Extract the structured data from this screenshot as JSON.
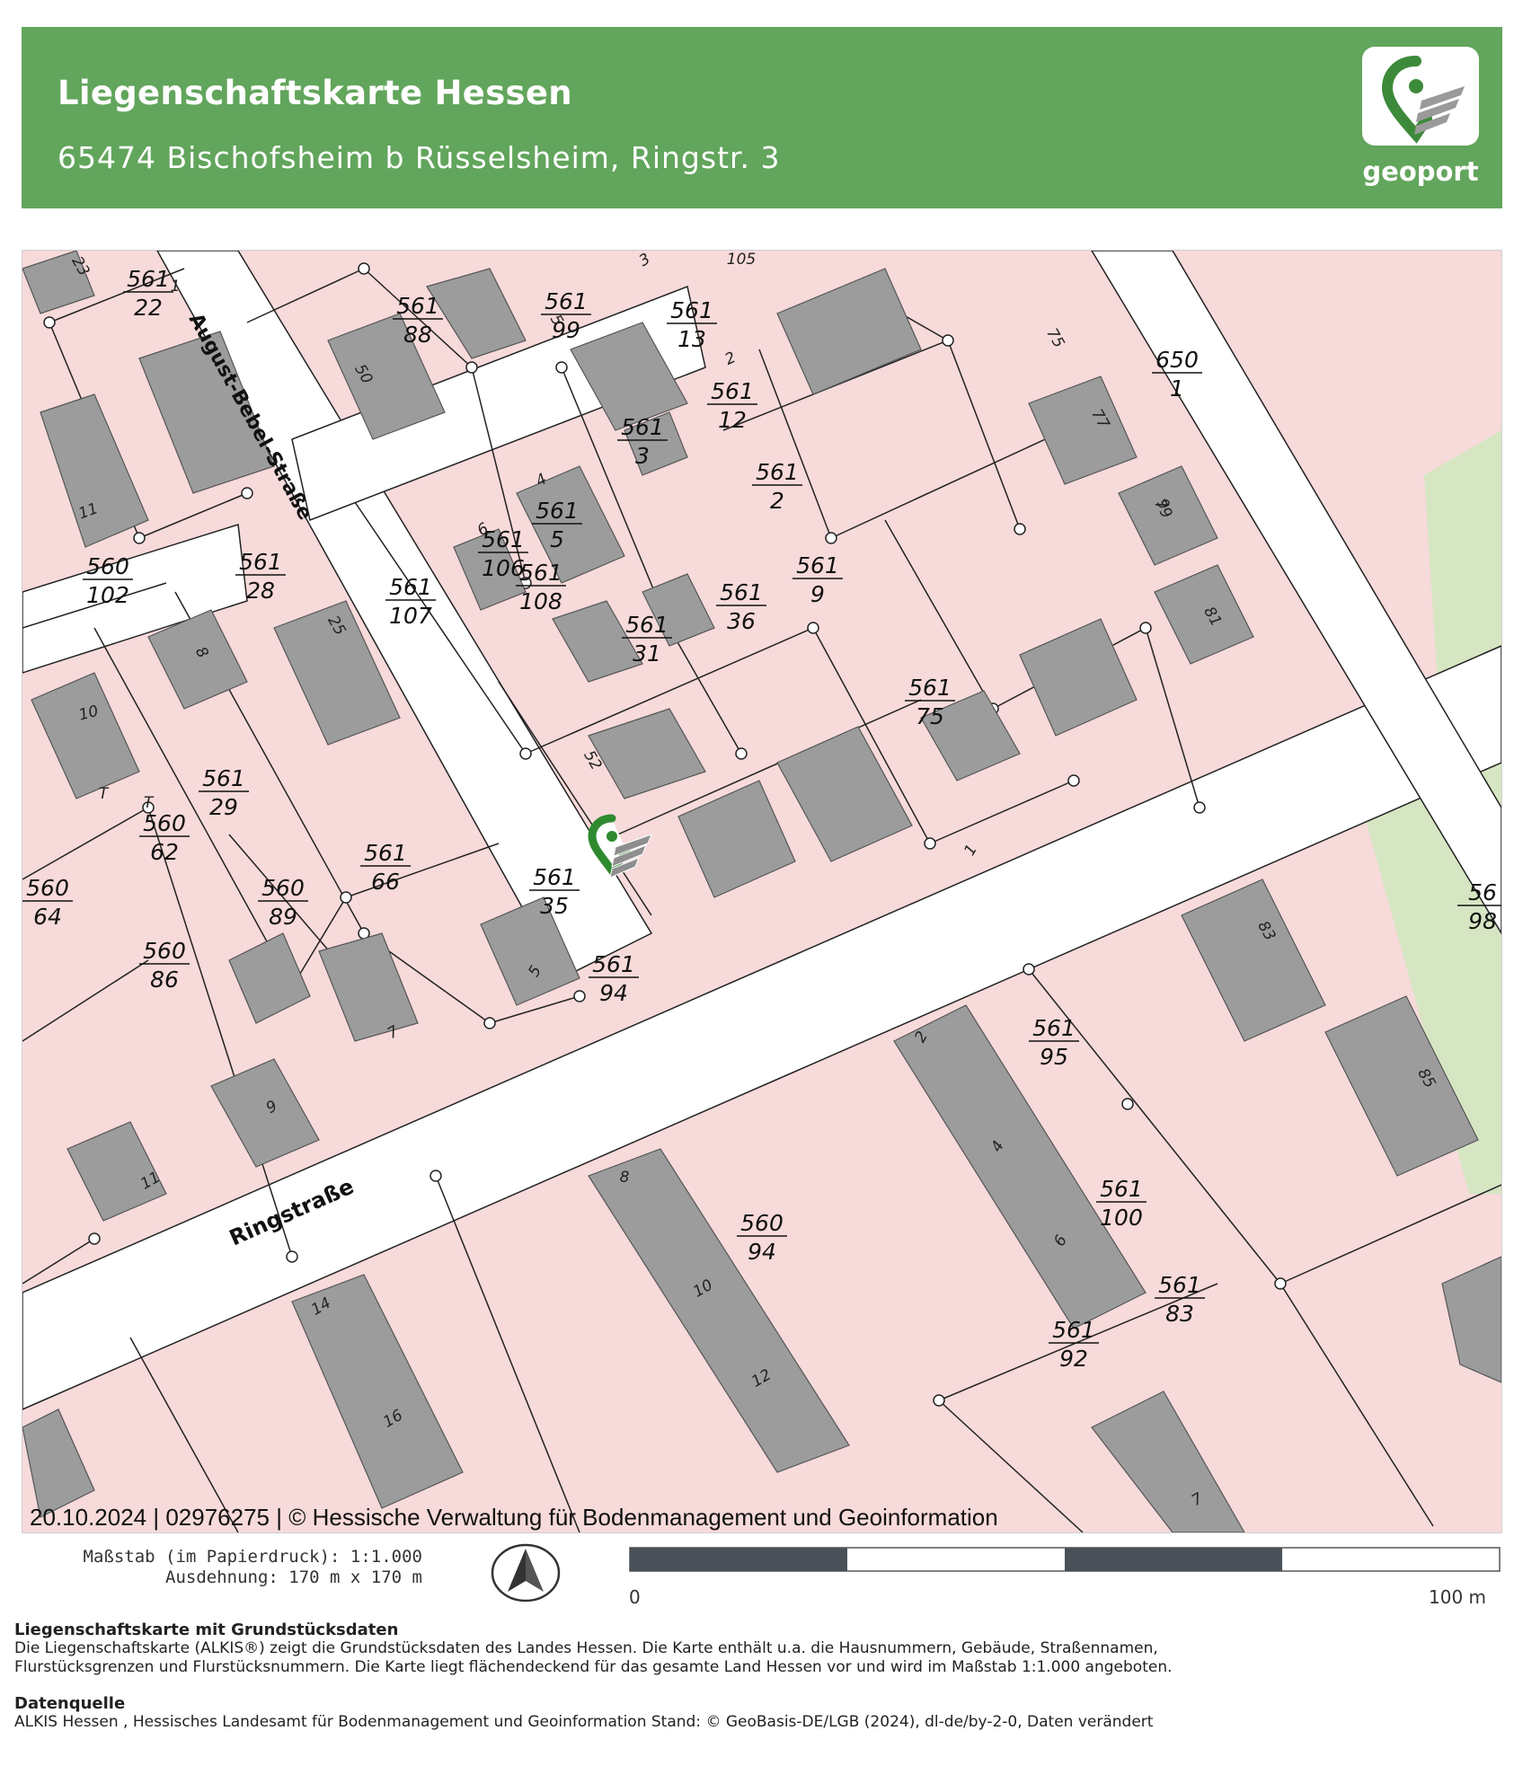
{
  "header": {
    "title": "Liegenschaftskarte Hessen",
    "address": "65474 Bischofsheim b Rüsselsheim, Ringstr. 3",
    "logo_text": "geoport",
    "background_color": "#62a55c"
  },
  "map": {
    "copyright": "20.10.2024 | 02976275 | © Hessische Verwaltung für Bodenmanagement und Geoinformation",
    "marker_icon": "location-pin-icon",
    "colors": {
      "parcel_fill": "#f7dada",
      "building_fill": "#9c9c9c",
      "green_fill": "#d6e6c3",
      "boundary": "#222222"
    },
    "streets": [
      "August-Bebel-Straße",
      "Ringstraße"
    ],
    "parcels": [
      {
        "top": "561",
        "bottom": "22"
      },
      {
        "top": "561",
        "bottom": "88"
      },
      {
        "top": "561",
        "bottom": "99"
      },
      {
        "top": "561",
        "bottom": "13"
      },
      {
        "top": "650",
        "bottom": "1"
      },
      {
        "top": "561",
        "bottom": "12"
      },
      {
        "top": "561",
        "bottom": "3"
      },
      {
        "top": "561",
        "bottom": "2"
      },
      {
        "top": "561",
        "bottom": "5"
      },
      {
        "top": "561",
        "bottom": "106"
      },
      {
        "top": "561",
        "bottom": "107"
      },
      {
        "top": "561",
        "bottom": "108"
      },
      {
        "top": "561",
        "bottom": "28"
      },
      {
        "top": "560",
        "bottom": "102"
      },
      {
        "top": "561",
        "bottom": "9"
      },
      {
        "top": "561",
        "bottom": "36"
      },
      {
        "top": "561",
        "bottom": "31"
      },
      {
        "top": "561",
        "bottom": "75"
      },
      {
        "top": "561",
        "bottom": "29"
      },
      {
        "top": "560",
        "bottom": "62"
      },
      {
        "top": "561",
        "bottom": "66"
      },
      {
        "top": "560",
        "bottom": "64"
      },
      {
        "top": "560",
        "bottom": "89"
      },
      {
        "top": "561",
        "bottom": "35"
      },
      {
        "top": "560",
        "bottom": "86"
      },
      {
        "top": "561",
        "bottom": "94"
      },
      {
        "top": "561",
        "bottom": "95"
      },
      {
        "top": "560",
        "bottom": "94"
      },
      {
        "top": "561",
        "bottom": "100"
      },
      {
        "top": "561",
        "bottom": "83"
      },
      {
        "top": "561",
        "bottom": "92"
      },
      {
        "top": "56",
        "bottom": "98"
      }
    ],
    "house_numbers": [
      "23",
      "1",
      "105",
      "3",
      "50",
      "5",
      "2",
      "75",
      "77",
      "9",
      "4",
      "6",
      "79",
      "11",
      "8",
      "25",
      "81",
      "10",
      "T",
      "T",
      "52",
      "1",
      "83",
      "5",
      "7",
      "9",
      "11",
      "2",
      "85",
      "4",
      "8",
      "6",
      "10",
      "12",
      "14",
      "16",
      "7"
    ]
  },
  "legend": {
    "scale_line1": "Maßstab (im Papierdruck): 1:1.000",
    "scale_line2": "Ausdehnung: 170 m x 170 m",
    "scale_start": "0",
    "scale_end": "100 m",
    "north_icon": "north-arrow-icon"
  },
  "info": {
    "heading1": "Liegenschaftskarte mit Grundstücksdaten",
    "text1_line1": "Die Liegenschaftskarte (ALKIS®) zeigt die Grundstücksdaten des Landes Hessen. Die Karte enthält u.a. die Hausnummern, Gebäude, Straßennamen,",
    "text1_line2": "Flurstücksgrenzen und Flurstücksnummern. Die Karte liegt flächendeckend für das gesamte Land Hessen vor und wird im Maßstab 1:1.000 angeboten.",
    "heading2": "Datenquelle",
    "text2": "ALKIS Hessen , Hessisches Landesamt für Bodenmanagement und Geoinformation Stand: © GeoBasis-DE/LGB (2024), dl-de/by-2-0, Daten verändert"
  }
}
